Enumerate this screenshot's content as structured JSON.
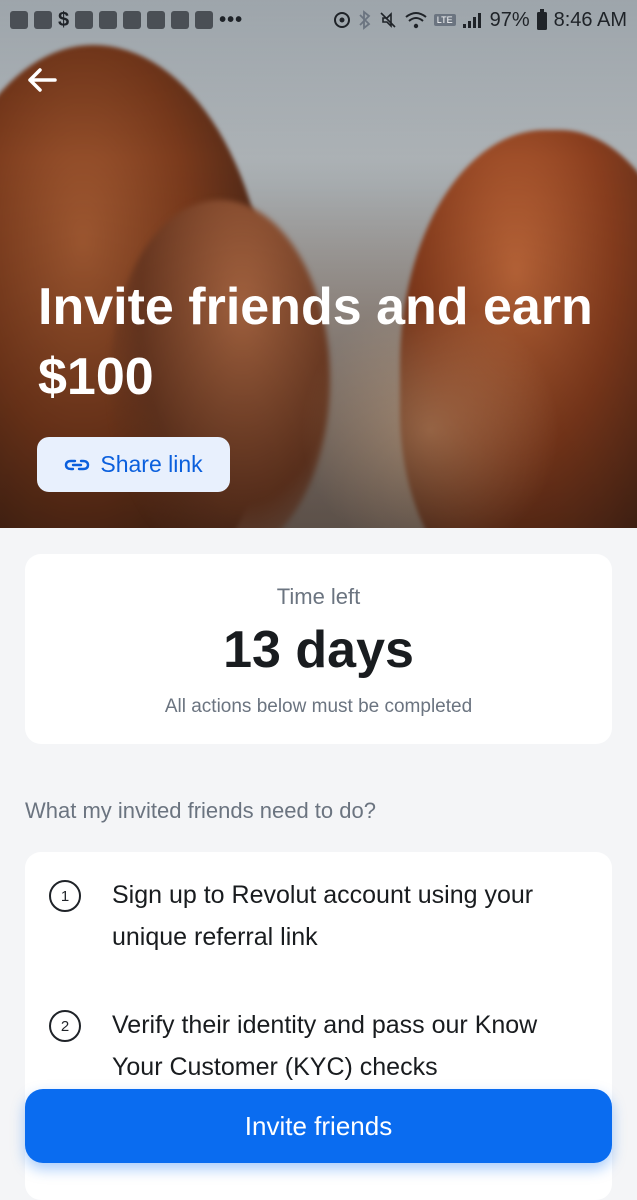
{
  "status_bar": {
    "dollar": "$",
    "dots": "•••",
    "battery": "97%",
    "time": "8:46 AM",
    "lte_badge": "LTE"
  },
  "hero": {
    "title": "Invite friends and earn $100",
    "share_label": "Share link"
  },
  "timer": {
    "label": "Time left",
    "value": "13 days",
    "note": "All actions below must be completed"
  },
  "requirements": {
    "heading": "What my invited friends need to do?",
    "steps": [
      {
        "number": "1",
        "text": "Sign up to Revolut account using your unique referral link"
      },
      {
        "number": "2",
        "text": "Verify their identity and pass our Know Your Customer (KYC) checks"
      }
    ]
  },
  "cta": {
    "label": "Invite friends"
  },
  "colors": {
    "accent": "#0a6cf0",
    "share_bg": "#e8f0fd",
    "background": "#f4f5f7"
  }
}
